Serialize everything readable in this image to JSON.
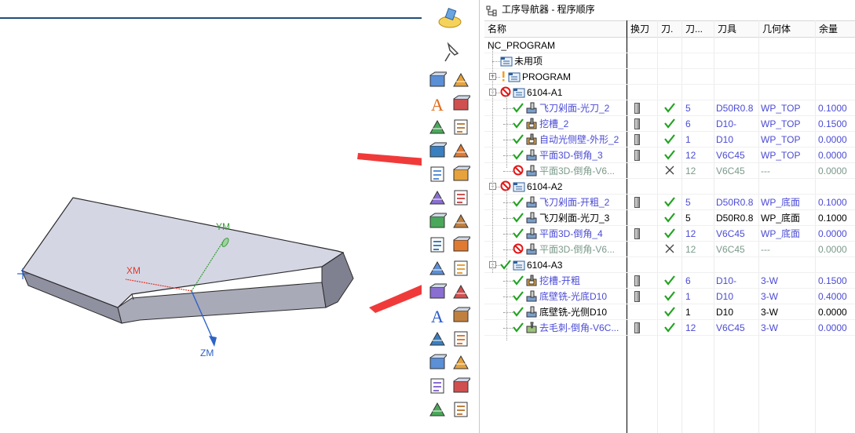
{
  "viewport": {
    "axes": {
      "xm": "XM",
      "ym": "YM",
      "zm": "ZM"
    },
    "colors": {
      "part_top": "#d5d6e4",
      "part_side": "#9c9caa",
      "edge": "#2b2b2b",
      "xm": "#e0392b",
      "ym": "#3a9a3a",
      "zm": "#2e62c7"
    }
  },
  "toolbar": {
    "icons": [
      "machine-tool-icon",
      "pin-icon",
      "part-navigator-icon",
      "operation-stack-icon",
      "text-icon",
      "layer-list-icon",
      "cube-color-icon",
      "tree-branch-icon",
      "mesh-icon",
      "feature-tree-icon",
      "eraser-icon",
      "drill-tool-icon",
      "image-box-icon",
      "angle-measure-icon",
      "book-icon",
      "nc-code-icon",
      "orange-box-icon",
      "cam-icon",
      "stack-box-icon",
      "pencil-ruler-icon",
      "flow-chart-icon",
      "text-tree-icon",
      "text-a-icon",
      "upload-arrow-icon",
      "fixture-icon",
      "download-arrow-icon",
      "spindle-icon",
      "steel-stamp-icon",
      "holder-icon",
      "green-stamp-icon",
      "tool-holder-icon",
      "red-t-icon"
    ]
  },
  "nav": {
    "title": "工序导航器 - 程序顺序",
    "headers": {
      "name": "名称",
      "tool_change": "换刀",
      "path": "刀.",
      "tool_no": "刀...",
      "tool": "刀具",
      "geometry": "几何体",
      "stock": "余量"
    },
    "rows": [
      {
        "name": "NC_PROGRAM",
        "indent": 0,
        "style": "black",
        "icon": "none",
        "status": "",
        "expand": "",
        "tc": false,
        "path": "",
        "tn": "",
        "tool": "",
        "geom": "",
        "stock": ""
      },
      {
        "name": "未用项",
        "indent": 1,
        "style": "black",
        "icon": "folder",
        "status": "",
        "expand": "",
        "tc": false,
        "path": "",
        "tn": "",
        "tool": "",
        "geom": "",
        "stock": ""
      },
      {
        "name": "PROGRAM",
        "indent": 1,
        "style": "black",
        "icon": "folder",
        "status": "warn",
        "expand": "+",
        "tc": false,
        "path": "",
        "tn": "",
        "tool": "",
        "geom": "",
        "stock": ""
      },
      {
        "name": "6104-A1",
        "indent": 1,
        "style": "black",
        "icon": "folder",
        "status": "ban",
        "expand": "-",
        "tc": false,
        "path": "",
        "tn": "",
        "tool": "",
        "geom": "",
        "stock": ""
      },
      {
        "name": "飞刀剁面-光刀_2",
        "indent": 2,
        "style": "blue",
        "icon": "face-op",
        "status": "ok",
        "expand": "",
        "tc": true,
        "path": "check",
        "tn": "5",
        "tool": "D50R0.8",
        "geom": "WP_TOP",
        "stock": "0.1000"
      },
      {
        "name": "挖槽_2",
        "indent": 2,
        "style": "blue",
        "icon": "cavity-op",
        "status": "ok",
        "expand": "",
        "tc": true,
        "path": "check",
        "tn": "6",
        "tool": "D10-",
        "geom": "WP_TOP",
        "stock": "0.1500"
      },
      {
        "name": "自动光侧壁-外形_2",
        "indent": 2,
        "style": "blue",
        "icon": "cavity-op",
        "status": "ok",
        "expand": "",
        "tc": true,
        "path": "check",
        "tn": "1",
        "tool": "D10",
        "geom": "WP_TOP",
        "stock": "0.0000"
      },
      {
        "name": "平面3D-倒角_3",
        "indent": 2,
        "style": "blue",
        "icon": "face-op",
        "status": "ok",
        "expand": "",
        "tc": true,
        "path": "check",
        "tn": "12",
        "tool": "V6C45",
        "geom": "WP_TOP",
        "stock": "0.0000"
      },
      {
        "name": "平面3D-倒角-V6...",
        "indent": 2,
        "style": "gray",
        "icon": "face-op",
        "status": "ban",
        "expand": "",
        "tc": false,
        "path": "cross",
        "tn": "12",
        "tool": "V6C45",
        "geom": "---",
        "stock": "0.0000"
      },
      {
        "name": "6104-A2",
        "indent": 1,
        "style": "black",
        "icon": "folder",
        "status": "ban",
        "expand": "-",
        "tc": false,
        "path": "",
        "tn": "",
        "tool": "",
        "geom": "",
        "stock": ""
      },
      {
        "name": "飞刀剁面-开粗_2",
        "indent": 2,
        "style": "blue",
        "icon": "face-op",
        "status": "ok",
        "expand": "",
        "tc": true,
        "path": "check",
        "tn": "5",
        "tool": "D50R0.8",
        "geom": "WP_底面",
        "stock": "0.1000"
      },
      {
        "name": "飞刀剁面-光刀_3",
        "indent": 2,
        "style": "black",
        "icon": "face-op",
        "status": "ok",
        "expand": "",
        "tc": false,
        "path": "check",
        "tn": "5",
        "tool": "D50R0.8",
        "geom": "WP_底面",
        "stock": "0.1000"
      },
      {
        "name": "平面3D-倒角_4",
        "indent": 2,
        "style": "blue",
        "icon": "face-op",
        "status": "ok",
        "expand": "",
        "tc": true,
        "path": "check",
        "tn": "12",
        "tool": "V6C45",
        "geom": "WP_底面",
        "stock": "0.0000"
      },
      {
        "name": "平面3D-倒角-V6...",
        "indent": 2,
        "style": "gray",
        "icon": "face-op",
        "status": "ban",
        "expand": "",
        "tc": false,
        "path": "cross",
        "tn": "12",
        "tool": "V6C45",
        "geom": "---",
        "stock": "0.0000"
      },
      {
        "name": "6104-A3",
        "indent": 1,
        "style": "black",
        "icon": "folder",
        "status": "ok",
        "expand": "-",
        "tc": false,
        "path": "",
        "tn": "",
        "tool": "",
        "geom": "",
        "stock": ""
      },
      {
        "name": "挖槽-开粗",
        "indent": 2,
        "style": "blue",
        "icon": "cavity-op",
        "status": "ok",
        "expand": "",
        "tc": true,
        "path": "check",
        "tn": "6",
        "tool": "D10-",
        "geom": "3-W",
        "stock": "0.1500"
      },
      {
        "name": "底壁铣-光底D10",
        "indent": 2,
        "style": "blue",
        "icon": "face-op",
        "status": "ok",
        "expand": "",
        "tc": true,
        "path": "check",
        "tn": "1",
        "tool": "D10",
        "geom": "3-W",
        "stock": "0.4000"
      },
      {
        "name": "底壁铣-光侧D10",
        "indent": 2,
        "style": "black",
        "icon": "face-op",
        "status": "ok",
        "expand": "",
        "tc": false,
        "path": "check",
        "tn": "1",
        "tool": "D10",
        "geom": "3-W",
        "stock": "0.0000"
      },
      {
        "name": "去毛刺-倒角-V6C...",
        "indent": 2,
        "style": "blue",
        "icon": "deburr-op",
        "status": "ok",
        "expand": "",
        "tc": true,
        "path": "check",
        "tn": "12",
        "tool": "V6C45",
        "geom": "3-W",
        "stock": "0.0000"
      }
    ]
  },
  "annotations": {
    "arrow_color": "#f03a3a"
  }
}
